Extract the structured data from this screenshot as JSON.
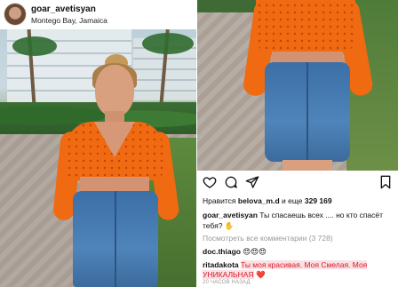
{
  "left_post": {
    "username": "goar_avetisyan",
    "location": "Montego Bay, Jamaica"
  },
  "right_post": {
    "likes_prefix": "Нравится",
    "likes_user": "belova_m.d",
    "likes_middle": "и еще",
    "likes_count": "329 169",
    "caption_user": "goar_avetisyan",
    "caption_text": "Ты спасаешь всех .... но кто спасёт тебя?",
    "caption_emoji": "✋",
    "view_all_comments": "Посмотреть все комментарии (3 728)",
    "comments": [
      {
        "user": "doc.thiago",
        "text": "😍😍😍"
      },
      {
        "user": "ritadakota",
        "text": "Ты моя красивая. Моя Смелая. Моя УНИКАЛЬНАЯ",
        "emoji": "❤️"
      }
    ],
    "timestamp": "20 ЧАСОВ НАЗАД"
  },
  "icons": {
    "avatar": "profile-avatar",
    "like": "heart-icon",
    "comment": "comment-icon",
    "share": "share-icon",
    "save": "bookmark-icon"
  },
  "colors": {
    "accent_highlight": "#d81b2b",
    "top": "#f06a12",
    "skirt": "#4f84ba"
  }
}
